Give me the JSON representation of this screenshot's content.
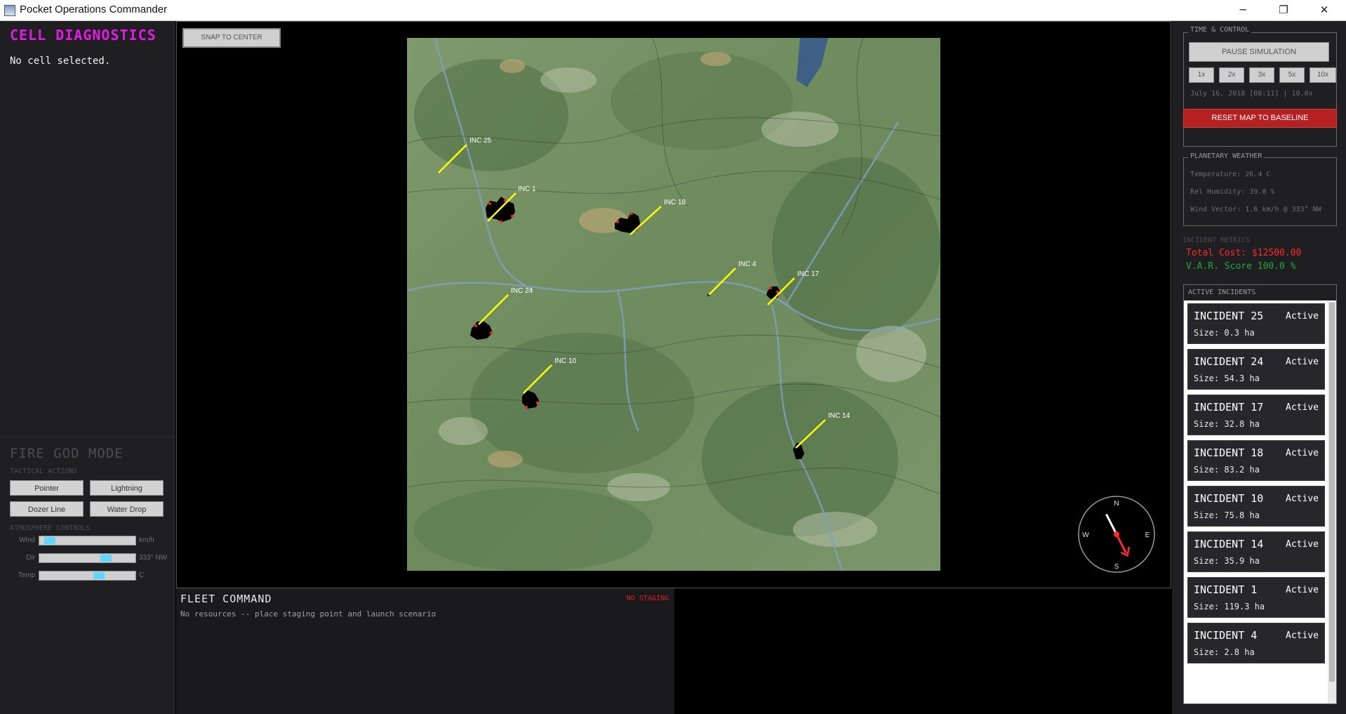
{
  "window": {
    "title": "Pocket Operations Commander",
    "minimize_glyph": "─",
    "maximize_glyph": "❐",
    "close_glyph": "✕"
  },
  "left_panel": {
    "cell_header": "CELL DIAGNOSTICS",
    "cell_info": "No cell selected.",
    "fire_god_header": "FIRE GOD MODE",
    "tactical_label": "TACTICAL ACTIONS",
    "tools": [
      "Pointer",
      "Lightning",
      "Dozer Line",
      "Water Drop"
    ],
    "atmosphere_label": "ATMOSPHERE CONTROLS",
    "sliders": [
      {
        "label": "Wind",
        "unit": "km/h",
        "level": 0.06
      },
      {
        "label": "Dir",
        "unit": "333° NW",
        "level": 0.72
      },
      {
        "label": "Temp",
        "unit": "C",
        "level": 0.64
      }
    ]
  },
  "map": {
    "snap_button": "SNAP TO CENTER",
    "incident_labels": [
      "INC 25",
      "INC 1",
      "INC 18",
      "INC 4",
      "INC 17",
      "INC 24",
      "INC 10",
      "INC 14"
    ],
    "compass": {
      "n": "N",
      "s": "S",
      "e": "E",
      "w": "W",
      "heading_deg": 333
    }
  },
  "fleet": {
    "header": "FLEET COMMAND",
    "status": "NO STAGING",
    "message": "No resources -- place staging point and launch scenario"
  },
  "right_panel": {
    "time_control": {
      "title": "TIME & CONTROL",
      "pause_button": "PAUSE SIMULATION",
      "speeds": [
        "1x",
        "2x",
        "3x",
        "5x",
        "10x"
      ],
      "sim_time": "July 16, 2018 [08:11] | 10.0x",
      "reset_button": "RESET MAP TO BASELINE"
    },
    "weather": {
      "title": "PLANETARY WEATHER",
      "temperature": "Temperature:  26.4 C",
      "humidity": "Rel Humidity: 39.0 %",
      "wind": "Wind Vector:  1.6 km/h @ 333° NW"
    },
    "metrics": {
      "title": "INCIDENT METRICS",
      "total_cost": "Total Cost:   $12500.00",
      "var_score": "V.A.R. Score  100.0 %",
      "cost_color": "#ff2a2a",
      "var_color": "#1fa83a"
    },
    "incidents_title": "ACTIVE INCIDENTS",
    "incidents": [
      {
        "name": "INCIDENT 25",
        "status": "Active",
        "size": "Size: 0.3 ha"
      },
      {
        "name": "INCIDENT 24",
        "status": "Active",
        "size": "Size: 54.3 ha"
      },
      {
        "name": "INCIDENT 17",
        "status": "Active",
        "size": "Size: 32.8 ha"
      },
      {
        "name": "INCIDENT 18",
        "status": "Active",
        "size": "Size: 83.2 ha"
      },
      {
        "name": "INCIDENT 10",
        "status": "Active",
        "size": "Size: 75.8 ha"
      },
      {
        "name": "INCIDENT 14",
        "status": "Active",
        "size": "Size: 35.9 ha"
      },
      {
        "name": "INCIDENT 1",
        "status": "Active",
        "size": "Size: 119.3 ha"
      },
      {
        "name": "INCIDENT 4",
        "status": "Active",
        "size": "Size: 2.8 ha"
      }
    ]
  }
}
